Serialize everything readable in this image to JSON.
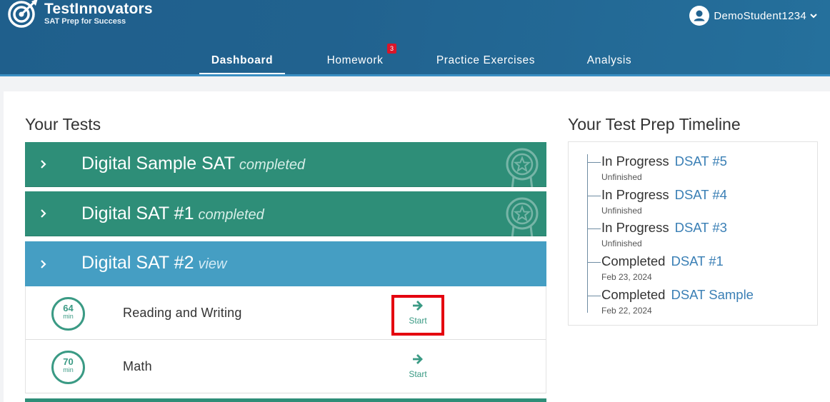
{
  "brand": {
    "title": "TestInnovators",
    "subtitle": "SAT Prep for Success"
  },
  "user": {
    "name": "DemoStudent1234"
  },
  "nav": {
    "items": [
      {
        "label": "Dashboard"
      },
      {
        "label": "Homework",
        "badge": "3"
      },
      {
        "label": "Practice Exercises"
      },
      {
        "label": "Analysis"
      }
    ]
  },
  "tests": {
    "title": "Your Tests",
    "items": [
      {
        "name": "Digital Sample SAT",
        "status": "completed"
      },
      {
        "name": "Digital SAT #1",
        "status": "completed"
      },
      {
        "name": "Digital SAT #2",
        "status": "view",
        "sections": [
          {
            "minutes": "64",
            "unit": "min",
            "name": "Reading and Writing",
            "action": "Start"
          },
          {
            "minutes": "70",
            "unit": "min",
            "name": "Math",
            "action": "Start"
          }
        ]
      }
    ]
  },
  "timeline": {
    "title": "Your Test Prep Timeline",
    "items": [
      {
        "state": "In Progress",
        "test": "DSAT #5",
        "sub": "Unfinished"
      },
      {
        "state": "In Progress",
        "test": "DSAT #4",
        "sub": "Unfinished"
      },
      {
        "state": "In Progress",
        "test": "DSAT #3",
        "sub": "Unfinished"
      },
      {
        "state": "Completed",
        "test": "DSAT #1",
        "sub": "Feb 23, 2024"
      },
      {
        "state": "Completed",
        "test": "DSAT Sample",
        "sub": "Feb 22, 2024"
      }
    ]
  },
  "colors": {
    "header": "#21628f",
    "green_row": "#2e8e78",
    "blue_row": "#459ec3",
    "accent": "#3a9a84",
    "link": "#3a7fb5",
    "highlight": "#e4000f",
    "badge": "#d9162a"
  }
}
